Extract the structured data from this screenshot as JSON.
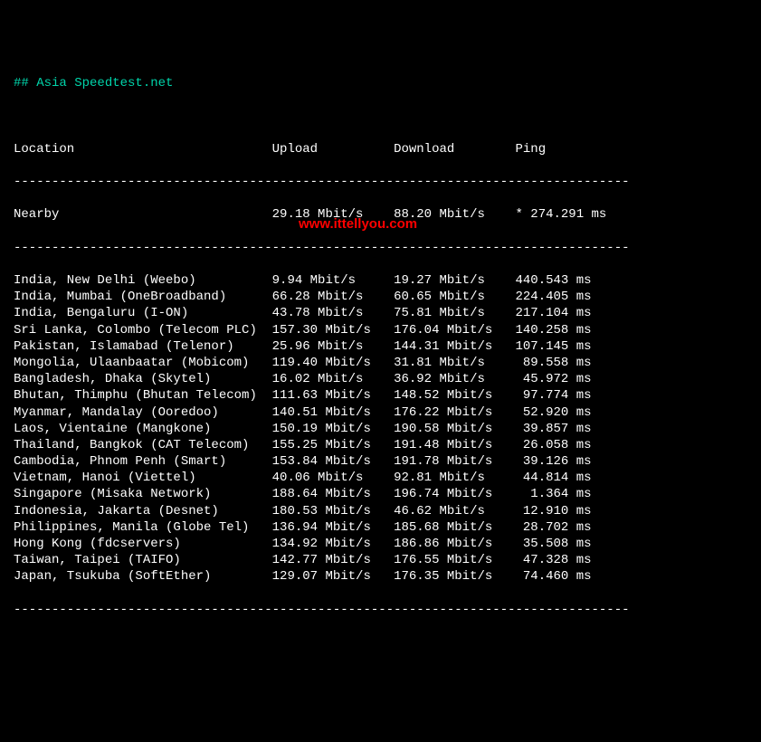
{
  "title": "## Asia Speedtest.net",
  "watermark": "www.ittellyou.com",
  "columns": {
    "location": "Location",
    "upload": "Upload",
    "download": "Download",
    "ping": "Ping"
  },
  "nearby": {
    "label": "Nearby",
    "upload": "29.18 Mbit/s",
    "download": "88.20 Mbit/s",
    "ping": "* 274.291 ms"
  },
  "separator": "---------------------------------------------------------------------------------",
  "rows": [
    {
      "location": "India, New Delhi (Weebo)",
      "upload": "9.94 Mbit/s",
      "download": "19.27 Mbit/s",
      "ping": "440.543 ms"
    },
    {
      "location": "India, Mumbai (OneBroadband)",
      "upload": "66.28 Mbit/s",
      "download": "60.65 Mbit/s",
      "ping": "224.405 ms"
    },
    {
      "location": "India, Bengaluru (I-ON)",
      "upload": "43.78 Mbit/s",
      "download": "75.81 Mbit/s",
      "ping": "217.104 ms"
    },
    {
      "location": "Sri Lanka, Colombo (Telecom PLC)",
      "upload": "157.30 Mbit/s",
      "download": "176.04 Mbit/s",
      "ping": "140.258 ms"
    },
    {
      "location": "Pakistan, Islamabad (Telenor)",
      "upload": "25.96 Mbit/s",
      "download": "144.31 Mbit/s",
      "ping": "107.145 ms"
    },
    {
      "location": "Mongolia, Ulaanbaatar (Mobicom)",
      "upload": "119.40 Mbit/s",
      "download": "31.81 Mbit/s",
      "ping": " 89.558 ms"
    },
    {
      "location": "Bangladesh, Dhaka (Skytel)",
      "upload": "16.02 Mbit/s",
      "download": "36.92 Mbit/s",
      "ping": " 45.972 ms"
    },
    {
      "location": "Bhutan, Thimphu (Bhutan Telecom)",
      "upload": "111.63 Mbit/s",
      "download": "148.52 Mbit/s",
      "ping": " 97.774 ms"
    },
    {
      "location": "Myanmar, Mandalay (Ooredoo)",
      "upload": "140.51 Mbit/s",
      "download": "176.22 Mbit/s",
      "ping": " 52.920 ms"
    },
    {
      "location": "Laos, Vientaine (Mangkone)",
      "upload": "150.19 Mbit/s",
      "download": "190.58 Mbit/s",
      "ping": " 39.857 ms"
    },
    {
      "location": "Thailand, Bangkok (CAT Telecom)",
      "upload": "155.25 Mbit/s",
      "download": "191.48 Mbit/s",
      "ping": " 26.058 ms"
    },
    {
      "location": "Cambodia, Phnom Penh (Smart)",
      "upload": "153.84 Mbit/s",
      "download": "191.78 Mbit/s",
      "ping": " 39.126 ms"
    },
    {
      "location": "Vietnam, Hanoi (Viettel)",
      "upload": "40.06 Mbit/s",
      "download": "92.81 Mbit/s",
      "ping": " 44.814 ms"
    },
    {
      "location": "Singapore (Misaka Network)",
      "upload": "188.64 Mbit/s",
      "download": "196.74 Mbit/s",
      "ping": "  1.364 ms"
    },
    {
      "location": "Indonesia, Jakarta (Desnet)",
      "upload": "180.53 Mbit/s",
      "download": "46.62 Mbit/s",
      "ping": " 12.910 ms"
    },
    {
      "location": "Philippines, Manila (Globe Tel)",
      "upload": "136.94 Mbit/s",
      "download": "185.68 Mbit/s",
      "ping": " 28.702 ms"
    },
    {
      "location": "Hong Kong (fdcservers)",
      "upload": "134.92 Mbit/s",
      "download": "186.86 Mbit/s",
      "ping": " 35.508 ms"
    },
    {
      "location": "Taiwan, Taipei (TAIFO)",
      "upload": "142.77 Mbit/s",
      "download": "176.55 Mbit/s",
      "ping": " 47.328 ms"
    },
    {
      "location": "Japan, Tsukuba (SoftEther)",
      "upload": "129.07 Mbit/s",
      "download": "176.35 Mbit/s",
      "ping": " 74.460 ms"
    }
  ]
}
